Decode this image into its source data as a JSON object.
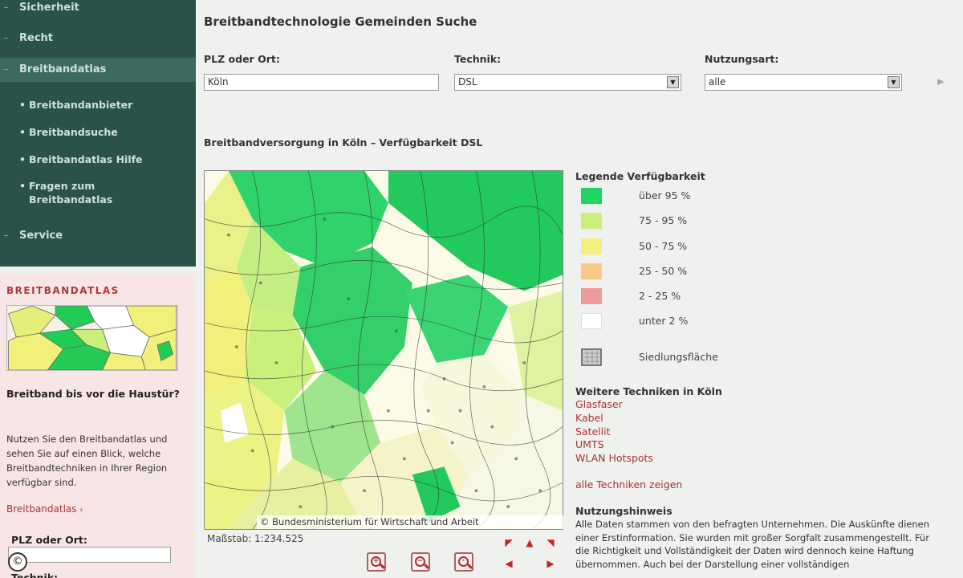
{
  "sidebar": {
    "nav_top": [
      {
        "label": "Sicherheit"
      },
      {
        "label": "Recht"
      }
    ],
    "active": {
      "label": "Breitbandatlas"
    },
    "sub_items": [
      {
        "label": "Breitbandanbieter"
      },
      {
        "label": "Breitbandsuche"
      },
      {
        "label": "Breitbandatlas Hilfe"
      },
      {
        "label": "Fragen zum Breitbandatlas"
      }
    ],
    "service": {
      "label": "Service"
    },
    "promo": {
      "title": "BREITBANDATLAS",
      "question": "Breitband bis vor die Haustür?",
      "description": "Nutzen Sie den Breitbandatlas und sehen Sie auf einen Blick, welche Breitbandtechniken in Ihrer Region verfügbar sind.",
      "link": "Breitbandatlas",
      "field_label": "PLZ oder Ort:",
      "cut_label": "Technik:"
    }
  },
  "main": {
    "title": "Breitbandtechnologie Gemeinden Suche",
    "form": {
      "plz_label": "PLZ oder Ort:",
      "plz_value": "Köln",
      "technik_label": "Technik:",
      "technik_value": "DSL",
      "nutzung_label": "Nutzungsart:",
      "nutzung_value": "alle"
    },
    "map_title": "Breitbandversorgung in Köln – Verfügbarkeit DSL",
    "copyright": "© Bundesministerium für Wirtschaft und Arbeit",
    "scale": "Maßstab: 1:234.525"
  },
  "legend": {
    "title": "Legende Verfügbarkeit",
    "items": [
      {
        "label": "über 95 %",
        "color": "#1ed760"
      },
      {
        "label": "75 - 95 %",
        "color": "#c8f07a"
      },
      {
        "label": "50 - 75 %",
        "color": "#f0f07a"
      },
      {
        "label": "25 - 50 %",
        "color": "#f7c98a"
      },
      {
        "label": "2 - 25 %",
        "color": "#ef9a9a"
      },
      {
        "label": "unter 2 %",
        "color": "#ffffff"
      }
    ],
    "settlement": {
      "label": "Siedlungsfläche"
    }
  },
  "more": {
    "title": "Weitere Techniken in Köln",
    "links": [
      "Glasfaser",
      "Kabel",
      "Satellit",
      "UMTS",
      "WLAN Hotspots"
    ],
    "all_link": "alle Techniken zeigen"
  },
  "hint": {
    "title": "Nutzungshinweis",
    "text": "Alle Daten stammen von den befragten Unternehmen. Die Auskünfte dienen einer Erstinformation. Sie wurden mit großer Sorgfalt zusammengestellt. Für die Richtigkeit und Vollständigkeit der Daten wird dennoch keine Haftung übernommen. Auch bei der Darstellung einer vollständigen"
  }
}
